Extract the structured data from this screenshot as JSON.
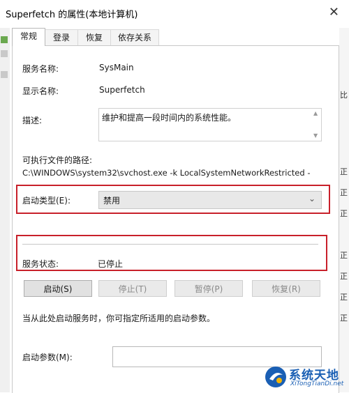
{
  "window": {
    "title": "Superfetch 的属性(本地计算机)",
    "close_glyph": "✕"
  },
  "tabs": [
    {
      "label": "常规",
      "active": true
    },
    {
      "label": "登录",
      "active": false
    },
    {
      "label": "恢复",
      "active": false
    },
    {
      "label": "依存关系",
      "active": false
    }
  ],
  "general": {
    "service_name_label": "服务名称:",
    "service_name_value": "SysMain",
    "display_name_label": "显示名称:",
    "display_name_value": "Superfetch",
    "description_label": "描述:",
    "description_value": "维护和提高一段时间内的系统性能。",
    "exe_path_label": "可执行文件的路径:",
    "exe_path_value": "C:\\WINDOWS\\system32\\svchost.exe -k LocalSystemNetworkRestricted -",
    "startup_type_label": "启动类型(E):",
    "startup_type_value": "禁用",
    "service_status_label": "服务状态:",
    "service_status_value": "已停止",
    "buttons": {
      "start": "启动(S)",
      "stop": "停止(T)",
      "pause": "暂停(P)",
      "resume": "恢复(R)"
    },
    "hint_text": "当从此处启动服务时，你可指定所适用的启动参数。",
    "start_params_label": "启动参数(M):",
    "start_params_value": ""
  },
  "background_right_labels": [
    "比",
    "正",
    "正",
    "正",
    "正",
    "正",
    "正",
    "正"
  ],
  "watermark": {
    "cn": "系统天地",
    "en": "XiTongTianDi.net"
  },
  "colors": {
    "highlight_red": "#c8202a",
    "watermark_blue": "#1a5fb4"
  }
}
